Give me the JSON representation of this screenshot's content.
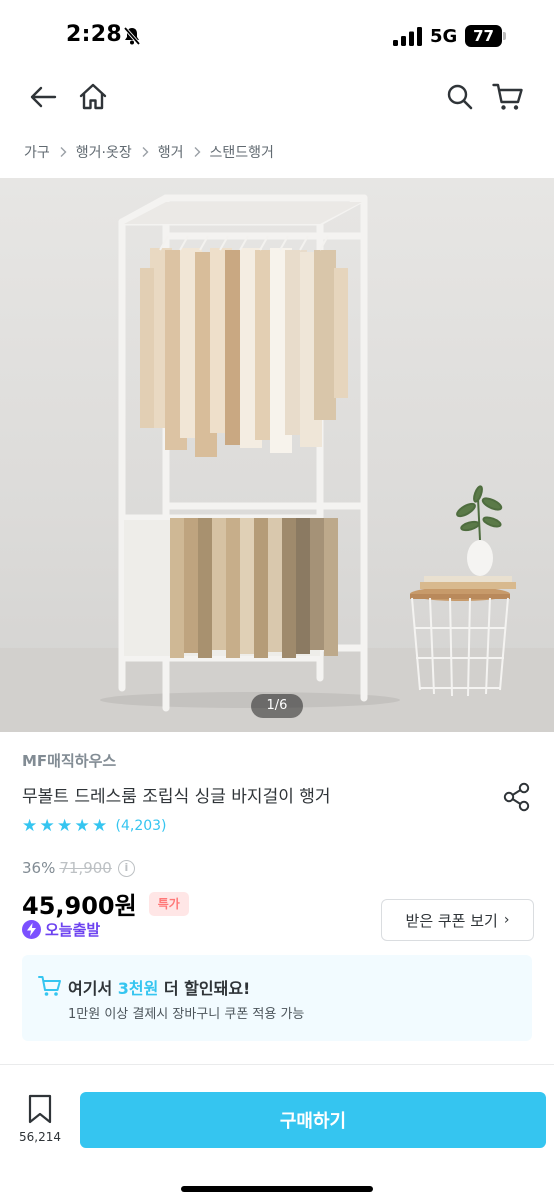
{
  "status": {
    "time": "2:28",
    "network": "5G",
    "battery": "77"
  },
  "nav": {
    "back": "back-icon",
    "home": "home-icon",
    "search": "search-icon",
    "cart": "cart-icon"
  },
  "breadcrumb": [
    "가구",
    "행거·옷장",
    "행거",
    "스탠드행거"
  ],
  "gallery": {
    "pager": "1/6"
  },
  "product": {
    "brand": "MF매직하우스",
    "title": "무볼트 드레스룸 조립식 싱글 바지걸이 행거",
    "rating_count": "(4,203)",
    "rating_stars": 5,
    "discount": "36%",
    "original_price": "71,900",
    "price": "45,900원",
    "badge": "특가",
    "shipping": "오늘출발",
    "coupon_button": "받은 쿠폰 보기",
    "coupon_chevron": "›"
  },
  "promo": {
    "head_prefix": "여기서 ",
    "head_highlight": "3천원",
    "head_suffix": " 더 할인돼요!",
    "sub": "1만원 이상 결제시 장바구니 쿠폰 적용 가능"
  },
  "bottom": {
    "bookmark_count": "56,214",
    "buy_label": "구매하기"
  },
  "colors": {
    "accent": "#35c5f0",
    "badge_bg": "#ffe6e6",
    "badge_fg": "#ff7777",
    "shipping": "#6d43f0"
  }
}
